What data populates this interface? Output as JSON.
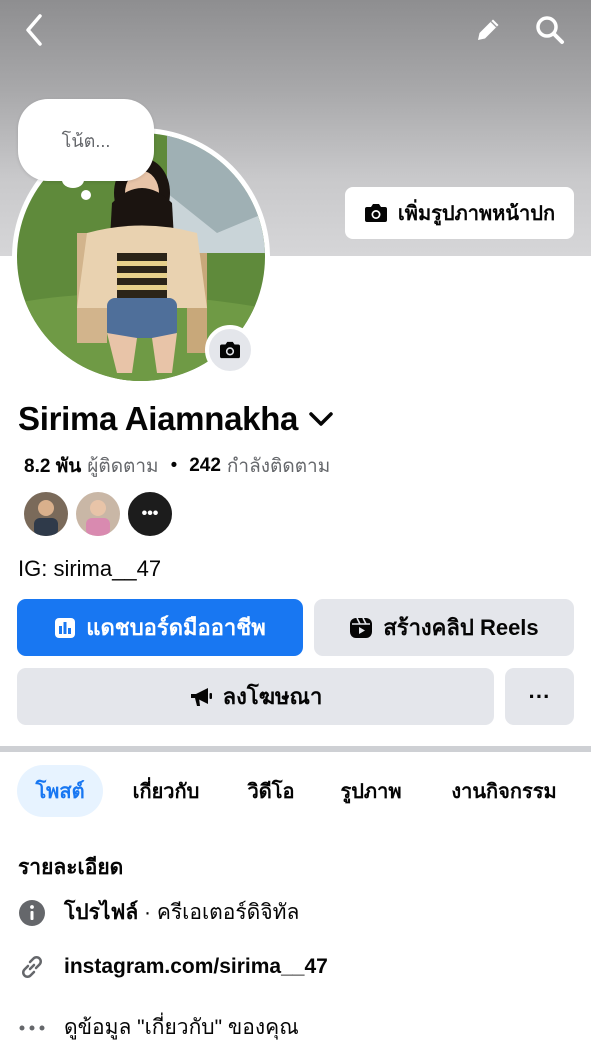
{
  "header": {
    "back_icon": "chevron-left-icon",
    "edit_icon": "pencil-icon",
    "search_icon": "search-icon"
  },
  "cover": {
    "add_cover_label": "เพิ่มรูปภาพหน้าปก"
  },
  "note": {
    "placeholder": "โน้ต..."
  },
  "profile": {
    "name": "Sirima Aiamnakha",
    "followers_count": "8.2 พัน",
    "followers_label": "ผู้ติดตาม",
    "following_count": "242",
    "following_label": "กำลังติดตาม",
    "separator": "•",
    "bio": "IG: sirima__47"
  },
  "actions": {
    "dashboard_label": "แดชบอร์ดมืออาชีพ",
    "reels_label": "สร้างคลิป Reels",
    "ads_label": "ลงโฆษณา",
    "more_label": "···"
  },
  "tabs": [
    {
      "label": "โพสต์",
      "active": true
    },
    {
      "label": "เกี่ยวกับ",
      "active": false
    },
    {
      "label": "วิดีโอ",
      "active": false
    },
    {
      "label": "รูปภาพ",
      "active": false
    },
    {
      "label": "งานกิจกรรม",
      "active": false
    }
  ],
  "details": {
    "title": "รายละเอียด",
    "profile_type": "โปรไฟล์",
    "profile_sep": " · ",
    "profile_category": "ครีเอเตอร์ดิจิทัล",
    "link": "instagram.com/sirima__47",
    "about_more": "ดูข้อมูล \"เกี่ยวกับ\" ของคุณ"
  },
  "colors": {
    "accent": "#1877f2",
    "button_grey": "#e4e6eb",
    "secondary_text": "#65676b"
  }
}
